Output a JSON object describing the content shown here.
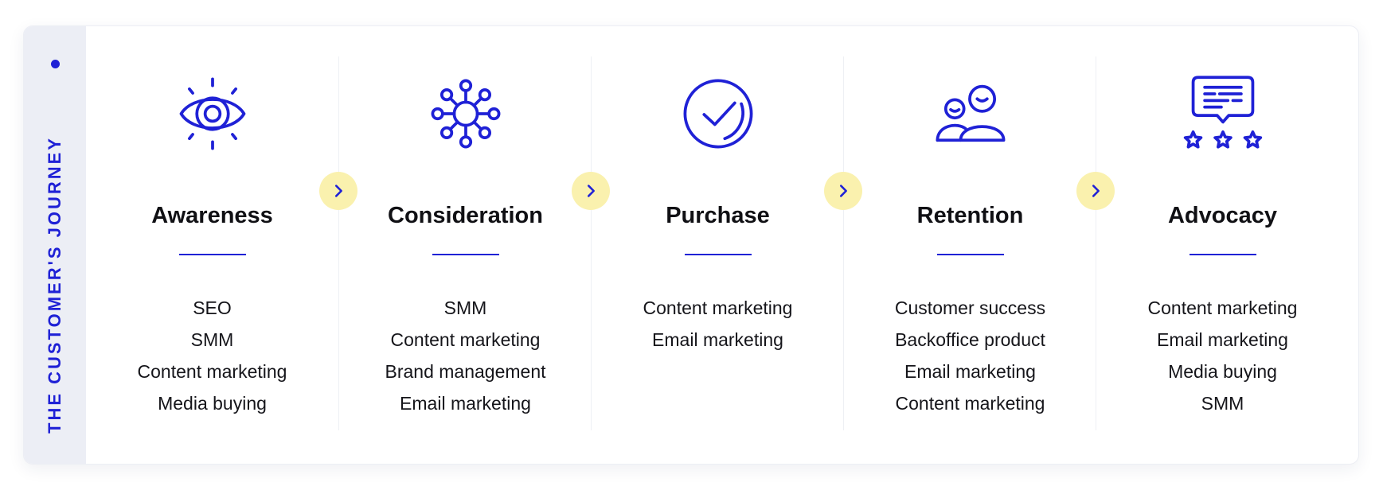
{
  "accent_color": "#1f21d6",
  "arrow_badge_color": "#faf1ae",
  "sidebar": {
    "title": "THE CUSTOMER'S JOURNEY"
  },
  "stages": [
    {
      "title": "Awareness",
      "icon": "eye-icon",
      "items": [
        "SEO",
        "SMM",
        "Content marketing",
        "Media buying"
      ]
    },
    {
      "title": "Consideration",
      "icon": "network-hub-icon",
      "items": [
        "SMM",
        "Content marketing",
        "Brand management",
        "Email marketing"
      ]
    },
    {
      "title": "Purchase",
      "icon": "checkmark-circle-icon",
      "items": [
        "Content marketing",
        "Email marketing"
      ]
    },
    {
      "title": "Retention",
      "icon": "people-icon",
      "items": [
        "Customer success",
        "Backoffice product",
        "Email marketing",
        "Content marketing"
      ]
    },
    {
      "title": "Advocacy",
      "icon": "review-stars-icon",
      "items": [
        "Content marketing",
        "Email marketing",
        "Media buying",
        "SMM"
      ]
    }
  ],
  "arrows": [
    "chevron-right-icon",
    "chevron-right-icon",
    "chevron-right-icon",
    "chevron-right-icon"
  ]
}
